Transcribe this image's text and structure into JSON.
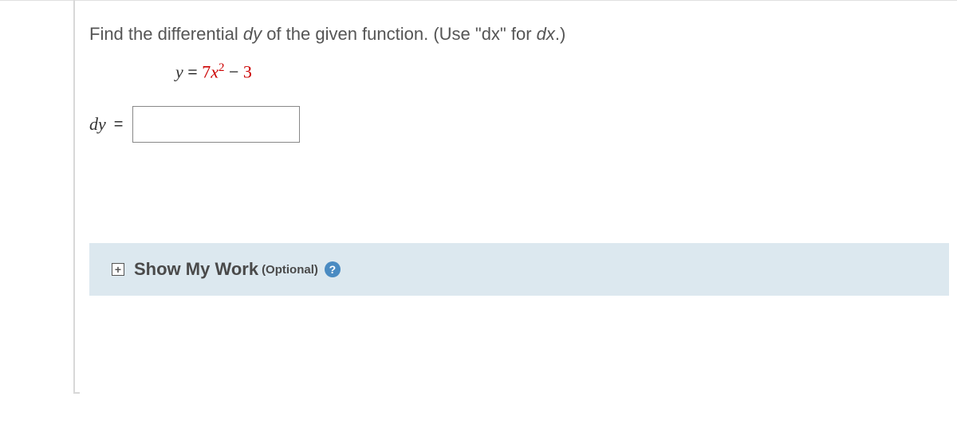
{
  "question": {
    "prompt_before_dy": "Find the differential ",
    "dy_text": "dy",
    "prompt_mid": " of the given function. (Use \"dx\" for ",
    "dx_text": "dx",
    "prompt_after": ".)"
  },
  "equation": {
    "lhs_var": "y",
    "equals": " = ",
    "coeff": "7",
    "base_var": "x",
    "exponent": "2",
    "minus": " − ",
    "constant": "3"
  },
  "answer": {
    "label": "dy",
    "equals": " = ",
    "value": ""
  },
  "show_work": {
    "expand_symbol": "+",
    "title": "Show My Work",
    "optional": "(Optional)",
    "help_symbol": "?"
  }
}
